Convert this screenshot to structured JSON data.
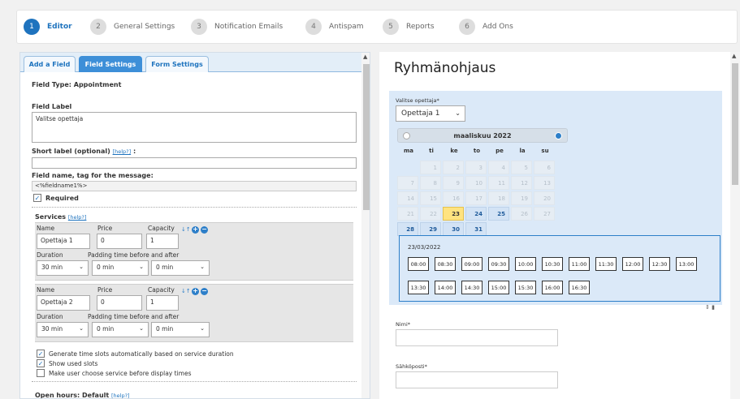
{
  "wizard": {
    "steps": [
      {
        "num": "1",
        "label": "Editor"
      },
      {
        "num": "2",
        "label": "General Settings"
      },
      {
        "num": "3",
        "label": "Notification Emails"
      },
      {
        "num": "4",
        "label": "Antispam"
      },
      {
        "num": "5",
        "label": "Reports"
      },
      {
        "num": "6",
        "label": "Add Ons"
      }
    ]
  },
  "left": {
    "tabs": [
      "Add a Field",
      "Field Settings",
      "Form Settings"
    ],
    "field_type": "Field Type: Appointment",
    "field_label_title": "Field Label",
    "field_label_value": "Valitse opettaja",
    "short_label_title": "Short label (optional)",
    "help": "[help?]",
    "short_label_suffix": ":",
    "fieldname_title": "Field name, tag for the message:",
    "fieldname_value": "<%fieldname1%>",
    "required_label": "Required",
    "services_title": "Services",
    "col_name": "Name",
    "col_price": "Price",
    "col_capacity": "Capacity",
    "col_duration": "Duration",
    "col_padding": "Padding time before and after",
    "services": [
      {
        "name": "Opettaja 1",
        "price": "0",
        "capacity": "1",
        "duration": "30 min",
        "pad_before": "0 min",
        "pad_after": "0 min"
      },
      {
        "name": "Opettaja 2",
        "price": "0",
        "capacity": "1",
        "duration": "30 min",
        "pad_before": "0 min",
        "pad_after": "0 min"
      }
    ],
    "opt_generate": "Generate time slots automatically based on service duration",
    "opt_show_used": "Show used slots",
    "opt_choose_service": "Make user choose service before display times",
    "open_hours": "Open hours: Default"
  },
  "preview": {
    "title": "Ryhmänohjaus",
    "select_label": "Valitse opettaja*",
    "select_value": "Opettaja 1",
    "calendar": {
      "month_year": "maaliskuu  2022",
      "dow": [
        "ma",
        "ti",
        "ke",
        "to",
        "pe",
        "la",
        "su"
      ],
      "weeks": [
        [
          "",
          "1",
          "2",
          "3",
          "4",
          "5",
          "6"
        ],
        [
          "7",
          "8",
          "9",
          "10",
          "11",
          "12",
          "13"
        ],
        [
          "14",
          "15",
          "16",
          "17",
          "18",
          "19",
          "20"
        ],
        [
          "21",
          "22",
          "23",
          "24",
          "25",
          "26",
          "27"
        ],
        [
          "28",
          "29",
          "30",
          "31",
          "",
          "",
          ""
        ]
      ],
      "available_days": [
        "24",
        "25",
        "28",
        "29",
        "30",
        "31"
      ],
      "selected_day": "23"
    },
    "selected_date": "23/03/2022",
    "slots_row1": [
      "08:00",
      "08:30",
      "09:00",
      "09:30",
      "10:00",
      "10:30",
      "11:00",
      "11:30",
      "12:00",
      "12:30",
      "13:00"
    ],
    "slots_row2": [
      "13:30",
      "14:00",
      "14:30",
      "15:00",
      "15:30",
      "16:00",
      "16:30"
    ],
    "name_label": "Nimi*",
    "email_label": "Sähköposti*"
  },
  "colors": {
    "accent": "#1e73be",
    "today": "#ffe380",
    "preview_bg": "#dbe9f8"
  }
}
